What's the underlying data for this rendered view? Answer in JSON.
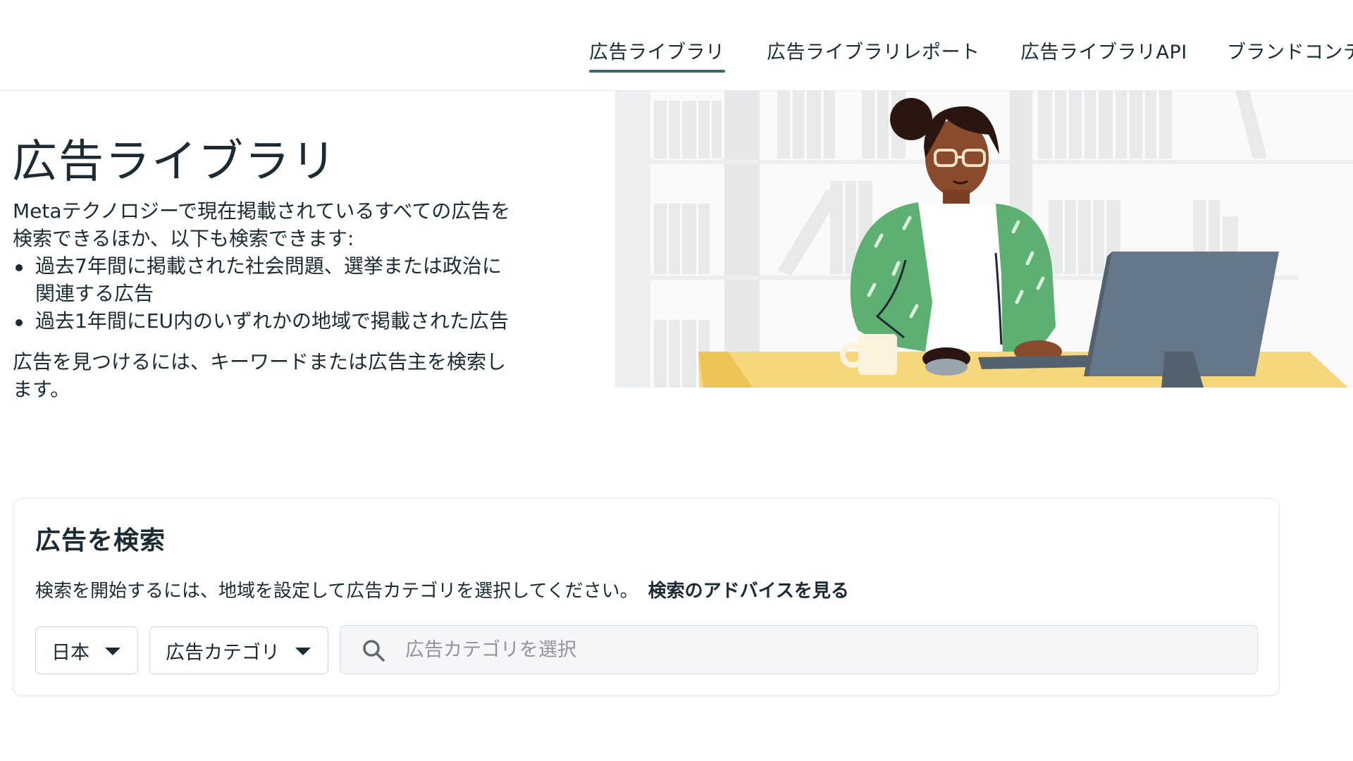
{
  "nav": {
    "tabs": [
      {
        "label": "広告ライブラリ",
        "active": true
      },
      {
        "label": "広告ライブラリレポート",
        "active": false
      },
      {
        "label": "広告ライブラリAPI",
        "active": false
      },
      {
        "label": "ブランドコンテ",
        "active": false
      }
    ]
  },
  "hero": {
    "title": "広告ライブラリ",
    "intro": "Metaテクノロジーで現在掲載されているすべての広告を検索できるほか、以下も検索できます:",
    "bullets": [
      "過去7年間に掲載された社会問題、選挙または政治に関連する広告",
      "過去1年間にEU内のいずれかの地域で掲載された広告"
    ],
    "find_text": "広告を見つけるには、キーワードまたは広告主を検索します。"
  },
  "search": {
    "title": "広告を検索",
    "description": "検索を開始するには、地域を設定して広告カテゴリを選択してください。",
    "tips_link": "検索のアドバイスを見る",
    "country_dropdown": "日本",
    "category_dropdown": "広告カテゴリ",
    "input_placeholder": "広告カテゴリを選択",
    "input_value": ""
  },
  "colors": {
    "text": "#1c2b33",
    "active_tab_underline": "#3b6a70",
    "search_bg": "#f5f6f7",
    "illustration_jacket": "#5eb072",
    "illustration_desk": "#f7d77b",
    "illustration_monitor": "#67778a"
  },
  "icons": {
    "search": "search-icon",
    "dropdown": "caret-down-icon"
  }
}
